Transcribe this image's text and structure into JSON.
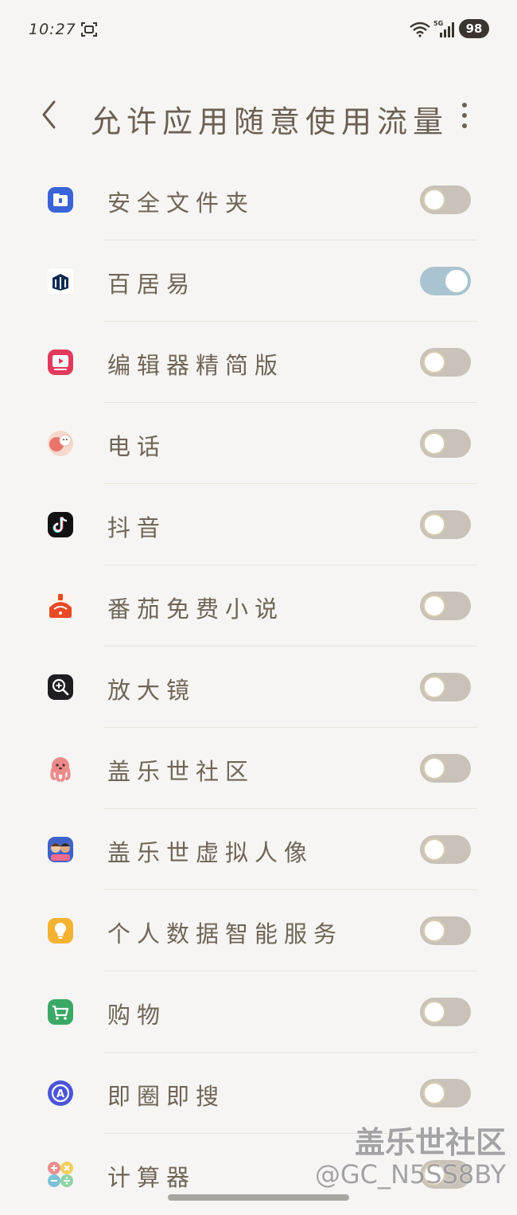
{
  "status_bar": {
    "time": "10:27",
    "network": "5G",
    "battery": "98"
  },
  "header": {
    "title": "允许应用随意使用流量"
  },
  "apps": [
    {
      "label": "安全文件夹",
      "icon": "secure-folder-icon",
      "enabled": false,
      "color": "#3a63d8"
    },
    {
      "label": "百居易",
      "icon": "baijuyi-icon",
      "enabled": true,
      "color": "#0c2a52"
    },
    {
      "label": "编辑器精简版",
      "icon": "video-editor-icon",
      "enabled": false,
      "color": "#e23a5c"
    },
    {
      "label": "电话",
      "icon": "phone-icon",
      "enabled": false,
      "color": "#e8746e"
    },
    {
      "label": "抖音",
      "icon": "douyin-icon",
      "enabled": false,
      "color": "#111111"
    },
    {
      "label": "番茄免费小说",
      "icon": "tomato-novel-icon",
      "enabled": false,
      "color": "#e84a25"
    },
    {
      "label": "放大镜",
      "icon": "magnifier-icon",
      "enabled": false,
      "color": "#1d1d22"
    },
    {
      "label": "盖乐世社区",
      "icon": "galaxy-community-icon",
      "enabled": false,
      "color": "#ec8a8a"
    },
    {
      "label": "盖乐世虚拟人像",
      "icon": "ar-emoji-icon",
      "enabled": false,
      "color": "#3f62c9"
    },
    {
      "label": "个人数据智能服务",
      "icon": "lightbulb-icon",
      "enabled": false,
      "color": "#f4b232"
    },
    {
      "label": "购物",
      "icon": "shopping-cart-icon",
      "enabled": false,
      "color": "#3aa866"
    },
    {
      "label": "即圈即搜",
      "icon": "circle-to-search-icon",
      "enabled": false,
      "color": "#4a55d8"
    },
    {
      "label": "计算器",
      "icon": "calculator-icon",
      "enabled": false,
      "color": "#f09a9a"
    }
  ],
  "watermark": {
    "title": "盖乐世社区",
    "user": "@GC_N5SS8BY"
  }
}
